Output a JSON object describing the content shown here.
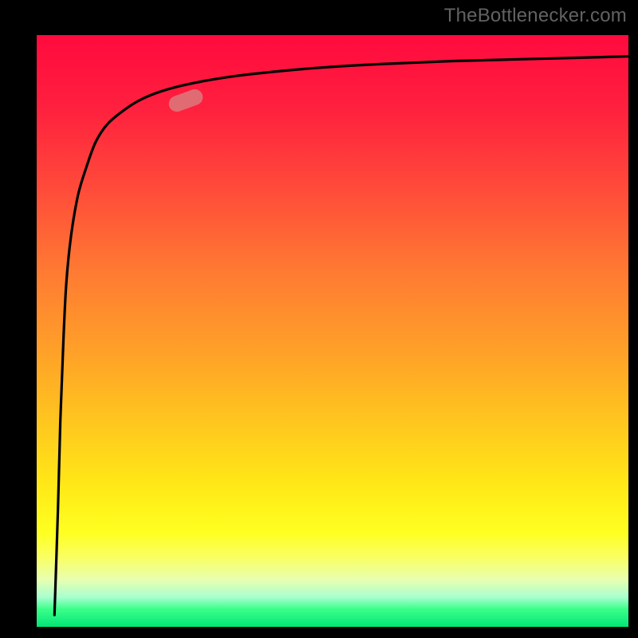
{
  "watermark": {
    "text": "TheBottlenecker.com"
  },
  "marker": {
    "color": "rgba(216,130,130,0.78)",
    "x_frac": 0.252,
    "y_top_frac": 0.11,
    "rotation_deg": -20
  },
  "chart_data": {
    "type": "line",
    "title": "",
    "xlabel": "",
    "ylabel": "",
    "xlim": [
      0,
      100
    ],
    "ylim": [
      0,
      100
    ],
    "grid": false,
    "legend": false,
    "marker_point": {
      "x": 28,
      "y": 87
    },
    "series": [
      {
        "name": "curve",
        "x": [
          3,
          3.6,
          4,
          4.5,
          5,
          5.8,
          7,
          8.5,
          10,
          12,
          15,
          18,
          22,
          27,
          33,
          40,
          48,
          58,
          70,
          85,
          100
        ],
        "y": [
          2,
          20,
          35,
          48,
          58,
          66,
          73,
          78,
          82,
          85,
          87.5,
          89.3,
          90.8,
          92,
          93,
          93.8,
          94.5,
          95.1,
          95.6,
          96,
          96.4
        ]
      }
    ],
    "background_gradient": {
      "direction": "top-to-bottom",
      "stops": [
        {
          "pos": 0.0,
          "color": "#ff0a3e"
        },
        {
          "pos": 0.26,
          "color": "#ff4b3a"
        },
        {
          "pos": 0.54,
          "color": "#ffa228"
        },
        {
          "pos": 0.76,
          "color": "#ffe817"
        },
        {
          "pos": 0.92,
          "color": "#e8ffb0"
        },
        {
          "pos": 1.0,
          "color": "#00e676"
        }
      ]
    }
  }
}
